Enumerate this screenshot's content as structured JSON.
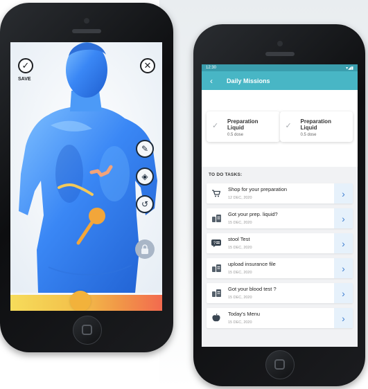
{
  "left_app": {
    "save_label": "SAVE",
    "colors": {
      "body_blue": "#3a87f5",
      "marker": "#f2a63a",
      "slider_start": "#f6dc5b",
      "slider_end": "#f26a4f"
    }
  },
  "right_app": {
    "status_time": "12:30",
    "status_icons": "▾◢▮",
    "title": "Daily Missions",
    "accent": "#48b6c5",
    "cards": [
      {
        "name": "Preparation Liquid",
        "dose": "0.5 dose"
      },
      {
        "name": "Preparation Liquid",
        "dose": "0.5 dose"
      }
    ],
    "todo_header": "TO DO TASKS:",
    "tasks": [
      {
        "name": "Shop for your preparation",
        "date": "12 DEC, 2020",
        "icon": "cart-icon"
      },
      {
        "name": "Got your prep. liquid?",
        "date": "15 DEC, 2020",
        "icon": "bottle-icon"
      },
      {
        "name": "stool Test",
        "date": "15 DEC, 2020",
        "icon": "chat-question-icon"
      },
      {
        "name": "upload insurance file",
        "date": "15 DEC, 2020",
        "icon": "document-icon"
      },
      {
        "name": "Got your blood test ?",
        "date": "15 DEC, 2020",
        "icon": "document-icon"
      },
      {
        "name": "Today's Menu",
        "date": "15 DEC, 2020",
        "icon": "apple-icon"
      }
    ]
  }
}
